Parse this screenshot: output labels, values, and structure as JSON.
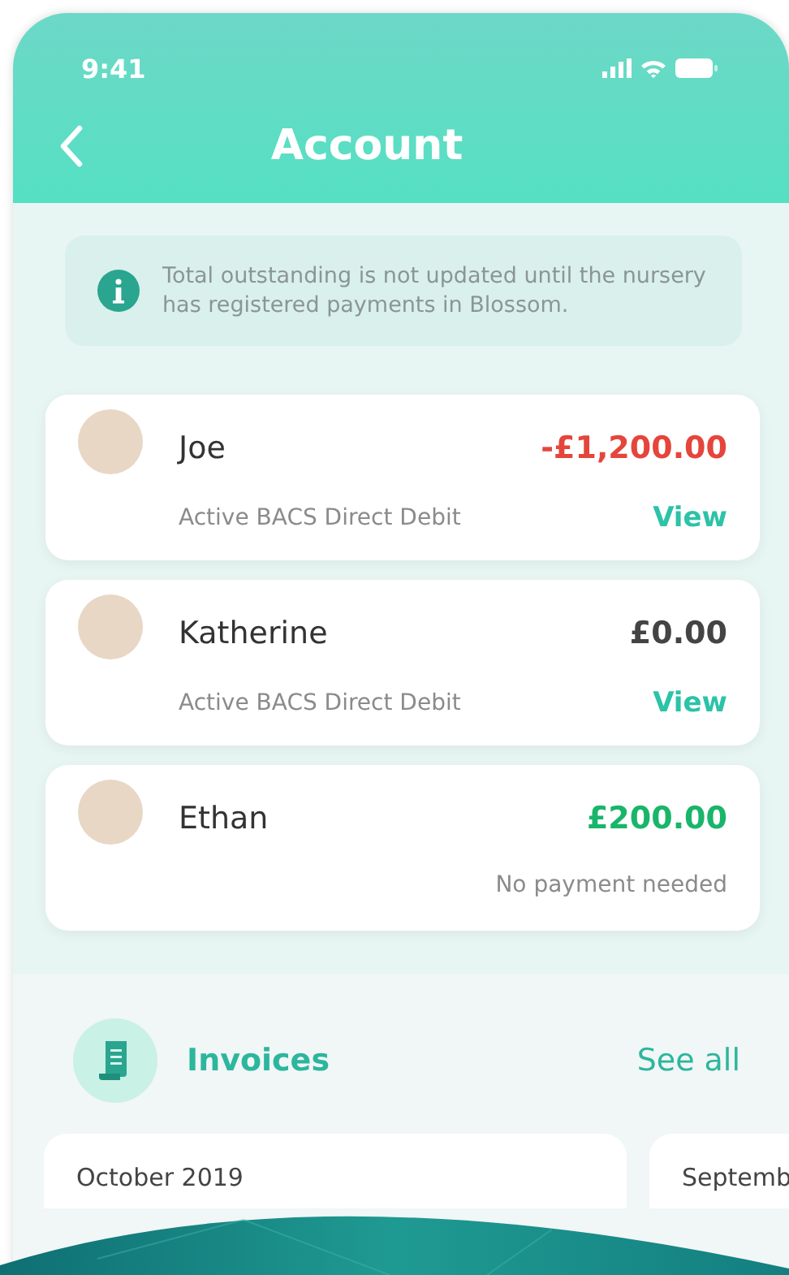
{
  "status_bar": {
    "time": "9:41"
  },
  "header": {
    "title": "Account"
  },
  "notice": {
    "text": "Total outstanding is not updated until the nursery has registered payments in Blossom."
  },
  "children": [
    {
      "name": "Joe",
      "amount": "-£1,200.00",
      "kind": "owing",
      "subtitle": "Active BACS Direct Debit",
      "link": "View"
    },
    {
      "name": "Katherine",
      "amount": "£0.00",
      "kind": "settled",
      "subtitle": "Active BACS Direct Debit",
      "link": "View"
    },
    {
      "name": "Ethan",
      "amount": "£200.00",
      "kind": "credit",
      "subtitle": "No payment needed"
    }
  ],
  "invoices": {
    "title": "Invoices",
    "see_all": "See all",
    "cards": [
      {
        "month": "October 2019"
      },
      {
        "month": "Septemb"
      }
    ]
  }
}
